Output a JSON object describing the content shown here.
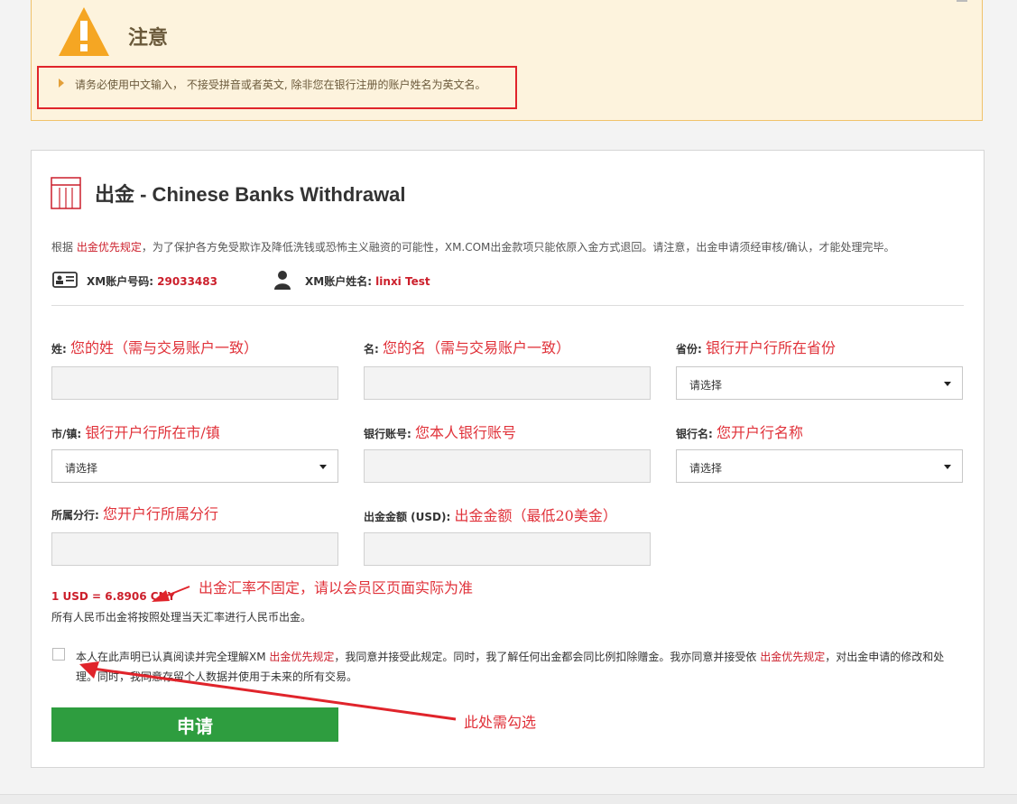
{
  "notice": {
    "title": "注意",
    "message": "请务必使用中文输入， 不接受拼音或者英文, 除非您在银行注册的账户姓名为英文名。"
  },
  "panel": {
    "title": "出金 - Chinese Banks Withdrawal",
    "desc_prefix": "根据 ",
    "desc_link": "出金优先规定",
    "desc_rest": "，为了保护各方免受欺诈及降低洗钱或恐怖主义融资的可能性，XM.COM出金款项只能依原入金方式退回。请注意，出金申请须经审核/确认，才能处理完毕。",
    "account_number_label": "XM账户号码: ",
    "account_number": "29033483",
    "account_name_label": "XM账户姓名: ",
    "account_name": "linxi Test"
  },
  "form": {
    "surname": {
      "label": "姓:",
      "hint": "您的姓（需与交易账户一致）"
    },
    "given_name": {
      "label": "名:",
      "hint": "您的名（需与交易账户一致）"
    },
    "province": {
      "label": "省份:",
      "hint": "银行开户行所在省份",
      "value": "请选择"
    },
    "city": {
      "label": "市/镇:",
      "hint": "银行开户行所在市/镇",
      "value": "请选择"
    },
    "bank_account": {
      "label": "银行账号:",
      "hint": "您本人银行账号"
    },
    "bank_name": {
      "label": "银行名:",
      "hint": "您开户行名称",
      "value": "请选择"
    },
    "branch": {
      "label": "所属分行:",
      "hint": "您开户行所属分行"
    },
    "amount": {
      "label": "出金金额 (USD):",
      "hint": "出金金额（最低20美金）"
    }
  },
  "rate": {
    "value": "1 USD = 6.8906 CNY",
    "note": "所有人民币出金将按照处理当天汇率进行人民币出金。",
    "hint": "出金汇率不固定，请以会员区页面实际为准"
  },
  "agreement": {
    "p1": "本人在此声明已认真阅读并完全理解XM ",
    "link1": "出金优先规定",
    "p2": "，我同意并接受此规定。同时，我了解任何出金都会同比例扣除赠金。我亦同意并接受依 ",
    "link2": "出金优先规定",
    "p3": "，对出金申请的修改和处理。同时，我同意存留个人数据并使用于未来的所有交易。"
  },
  "submit_label": "申请",
  "check_hint": "此处需勾选",
  "colors": {
    "accent_red": "#cc1f2b",
    "submit_green": "#2e9d3f",
    "notice_bg": "#fdf3dd",
    "annotation_red": "#e0323a"
  }
}
